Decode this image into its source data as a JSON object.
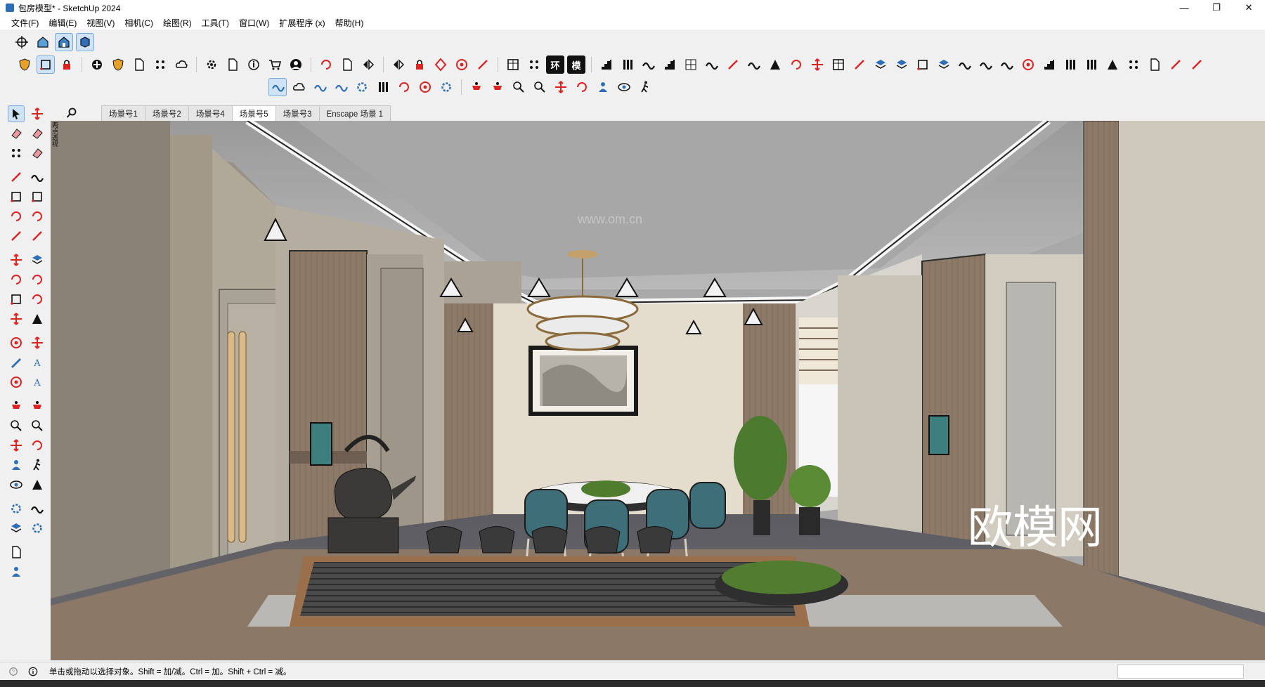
{
  "window": {
    "title": "包房模型* - SketchUp 2024",
    "controls": [
      "—",
      "❐",
      "✕"
    ]
  },
  "menu": [
    "文件(F)",
    "编辑(E)",
    "视图(V)",
    "相机(C)",
    "绘图(R)",
    "工具(T)",
    "窗口(W)",
    "扩展程序 (x)",
    "帮助(H)"
  ],
  "scenes": {
    "tabs": [
      "场景号1",
      "场景号2",
      "场景号4",
      "场景号5",
      "场景号3",
      "Enscape 场景 1"
    ],
    "active": "场景号5"
  },
  "toolbar_text_buttons": [
    "环",
    "模"
  ],
  "viewport": {
    "corner_label": "两点透视",
    "watermark_brand": "欧模网",
    "watermark_url": "www.om.cn"
  },
  "status": {
    "hint": "单击或拖动以选择对象。Shift = 加/减。Ctrl = 加。Shift + Ctrl = 减。"
  },
  "colors": {
    "ui_bg": "#f0f0f0",
    "active_tool": "#cfe3f7",
    "wall_wood": "#8a7665",
    "teal_chair": "#3e6f78"
  }
}
